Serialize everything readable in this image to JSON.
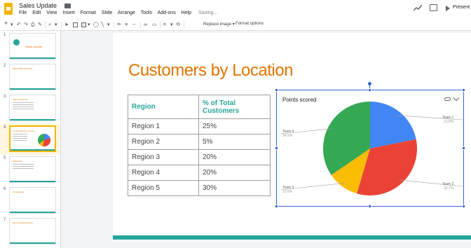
{
  "app": {
    "doc_title": "Sales Update",
    "menu": [
      "File",
      "Edit",
      "View",
      "Insert",
      "Format",
      "Slide",
      "Arrange",
      "Tools",
      "Add-ons",
      "Help"
    ],
    "saving_status": "Saving...",
    "present_label": "Present"
  },
  "toolbar": {
    "replace_image": "Replace image ▾",
    "format_options": "Format options"
  },
  "filmstrip": {
    "slides": [
      {
        "num": "1",
        "title": "Sales Update"
      },
      {
        "num": "2",
        "title": "Sales Data Summary"
      },
      {
        "num": "3",
        "title": "Sales Channels"
      },
      {
        "num": "4",
        "title": "Customers by Location"
      },
      {
        "num": "5",
        "title": "Marketing"
      },
      {
        "num": "6",
        "title": "Conclusions"
      },
      {
        "num": "7",
        "title": "Items & Opportunities"
      }
    ]
  },
  "slide": {
    "title": "Customers by Location",
    "table": {
      "headers": [
        "Region",
        "% of Total Customers"
      ],
      "rows": [
        [
          "Region 1",
          "25%"
        ],
        [
          "Region 2",
          "5%"
        ],
        [
          "Region 3",
          "20%"
        ],
        [
          "Region 4",
          "20%"
        ],
        [
          "Region 5",
          "30%"
        ]
      ]
    }
  },
  "chart_data": {
    "type": "pie",
    "title": "Points scored",
    "slices": [
      {
        "name": "Team 1",
        "value": 21.8,
        "label": "21.8%",
        "color": "#4285f4"
      },
      {
        "name": "Team 2",
        "value": 32.7,
        "label": "32.7%",
        "color": "#ea4335"
      },
      {
        "name": "Team 3",
        "value": 10.9,
        "label": "10.9%",
        "color": "#fbbc04"
      },
      {
        "name": "Team 4",
        "value": 34.5,
        "label": "34.5%",
        "color": "#34a853"
      }
    ]
  },
  "colors": {
    "accent": "#e37400",
    "teal": "#26a69a",
    "selection": "#3367d6"
  }
}
